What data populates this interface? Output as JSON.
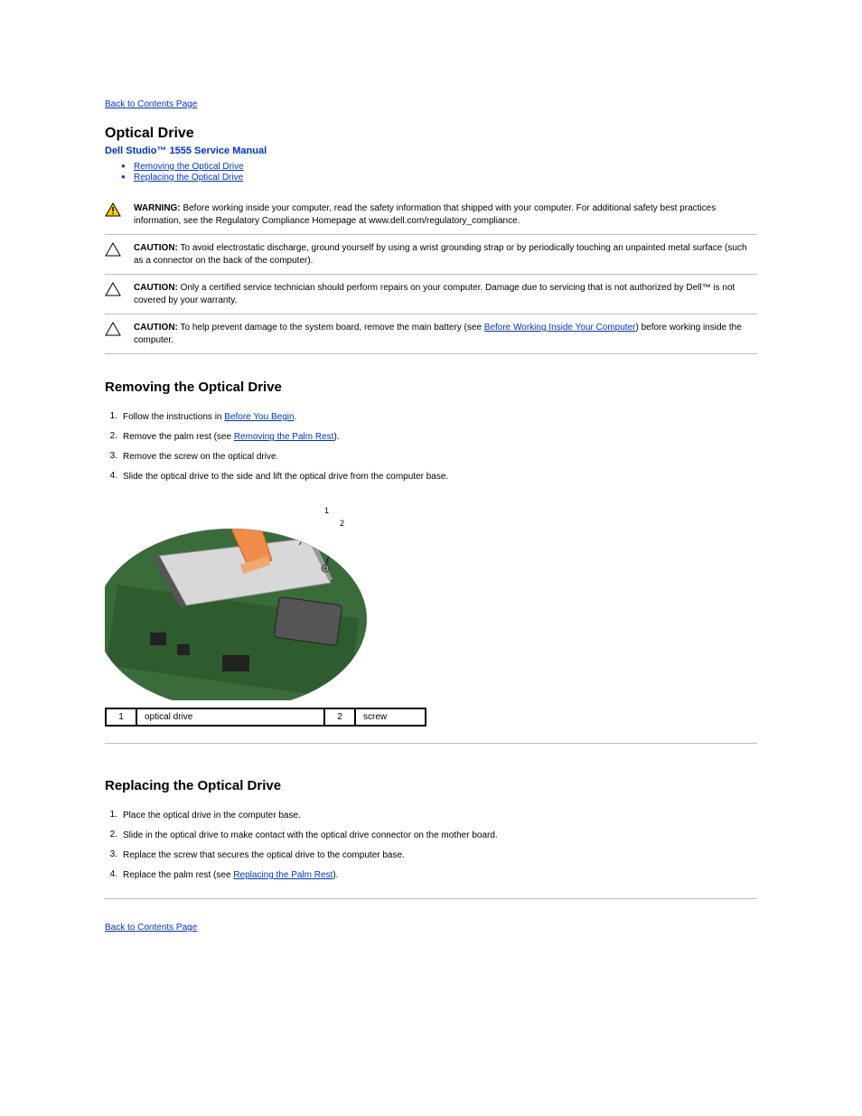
{
  "nav": {
    "back_top": "Back to Contents Page",
    "back_bottom": "Back to Contents Page"
  },
  "header": {
    "title": "Optical Drive",
    "subtitle": "Dell Studio™ 1555 Service Manual"
  },
  "toc": {
    "removing": "Removing the Optical Drive",
    "replacing": "Replacing the Optical Drive"
  },
  "notices": {
    "warning_lead": "WARNING:",
    "warning_body": " Before working inside your computer, read the safety information that shipped with your computer. For additional safety best practices information, see the Regulatory Compliance Homepage at www.dell.com/regulatory_compliance.",
    "caution1_lead": "CAUTION:",
    "caution1_body": " To avoid electrostatic discharge, ground yourself by using a wrist grounding strap or by periodically touching an unpainted metal surface (such as a connector on the back of the computer).",
    "caution2_lead": "CAUTION:",
    "caution2_body_a": " Only a certified service technician should perform repairs on your computer. Damage due to servicing that is not authorized by Dell™ is not covered by your warranty.",
    "caution3_lead": "CAUTION:",
    "caution3_body_a": " To help prevent damage to the system board, remove the main battery (see ",
    "caution3_link": "Before Working Inside Your Computer",
    "caution3_body_b": ") before working inside the computer."
  },
  "removing": {
    "title": "Removing the Optical Drive",
    "steps": [
      {
        "num": "1.",
        "before": "Follow the instructions in ",
        "link": "Before You Begin",
        "after": "."
      },
      {
        "num": "2.",
        "before": "Remove the palm rest (see ",
        "link": "Removing the Palm Rest",
        "after": ")."
      },
      {
        "num": "3.",
        "before": "Remove the screw on the optical drive.",
        "link": "",
        "after": ""
      },
      {
        "num": "4.",
        "before": "Slide the optical drive to the side and lift the optical drive from the computer base.",
        "link": "",
        "after": ""
      }
    ]
  },
  "callouts": {
    "c1num": "1",
    "c1label": "optical drive",
    "c2num": "2",
    "c2label": "screw"
  },
  "replacing": {
    "title": "Replacing the Optical Drive",
    "steps": [
      {
        "num": "1.",
        "before": "Place the optical drive in the computer base.",
        "link": "",
        "after": ""
      },
      {
        "num": "2.",
        "before": "Slide in the optical drive to make contact with the optical drive connector on the mother board.",
        "link": "",
        "after": ""
      },
      {
        "num": "3.",
        "before": "Replace the screw that secures the optical drive to the computer base.",
        "link": "",
        "after": ""
      },
      {
        "num": "4.",
        "before": "Replace the palm rest (see ",
        "link": "Replacing the Palm Rest",
        "after": ")."
      }
    ]
  }
}
